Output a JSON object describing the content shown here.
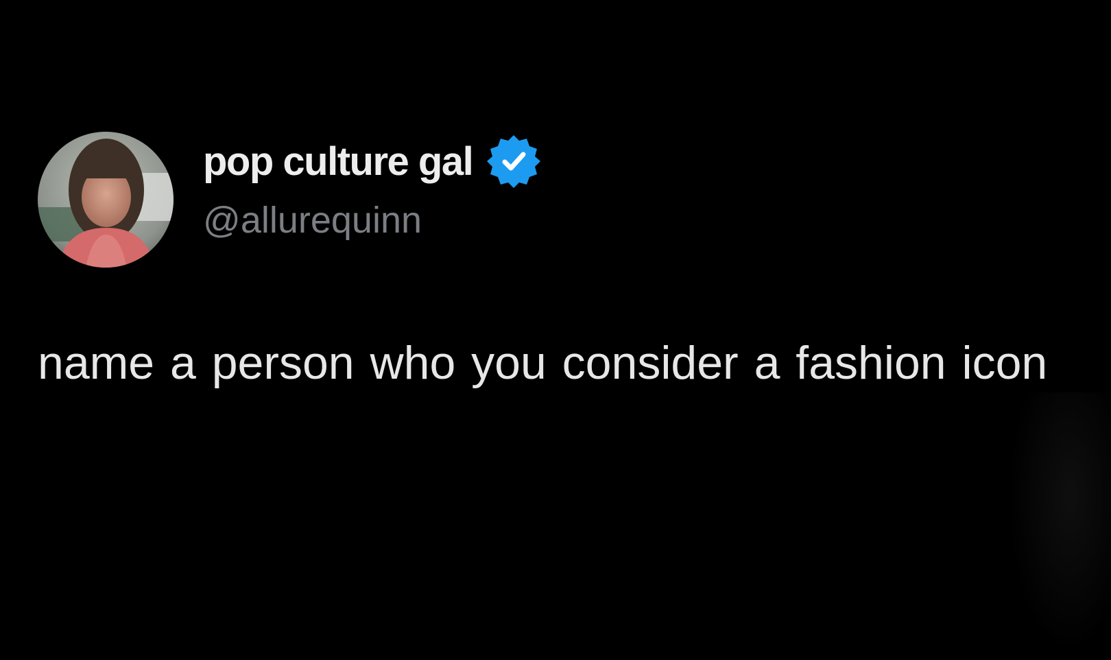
{
  "author": {
    "display_name": "pop culture gal",
    "handle": "@allurequinn",
    "verified": true
  },
  "tweet": {
    "text": "name a  person  who you consider a fashion icon"
  },
  "colors": {
    "background": "#000000",
    "name": "#ededed",
    "handle": "#7b7f84",
    "text": "#e7e7e7",
    "verified_badge": "#1d9bf0"
  },
  "icons": {
    "avatar": "profile-photo",
    "badge": "verified-badge-icon"
  }
}
